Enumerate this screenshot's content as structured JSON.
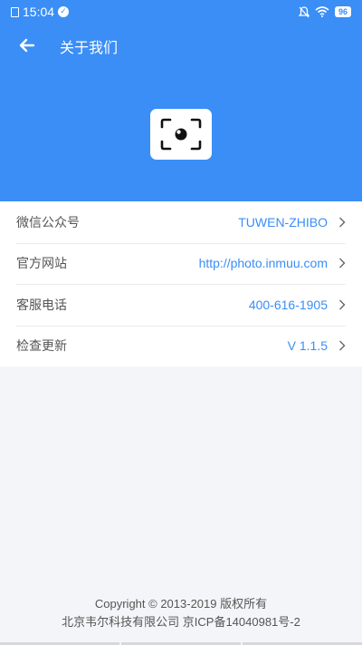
{
  "status_bar": {
    "time": "15:04",
    "battery": "96"
  },
  "header": {
    "title": "关于我们",
    "back_icon": "arrow-left-icon",
    "logo_icon": "camera-focus-icon",
    "background_color": "#3a8ef6"
  },
  "rows": [
    {
      "label": "微信公众号",
      "value": "TUWEN-ZHIBO"
    },
    {
      "label": "官方网站",
      "value": "http://photo.inmuu.com"
    },
    {
      "label": "客服电话",
      "value": "400-616-1905"
    },
    {
      "label": "检查更新",
      "value": "V 1.1.5"
    }
  ],
  "footer": {
    "copyright": "Copyright © 2013-2019 版权所有",
    "company": "北京韦尔科技有限公司 京ICP备14040981号-2"
  }
}
